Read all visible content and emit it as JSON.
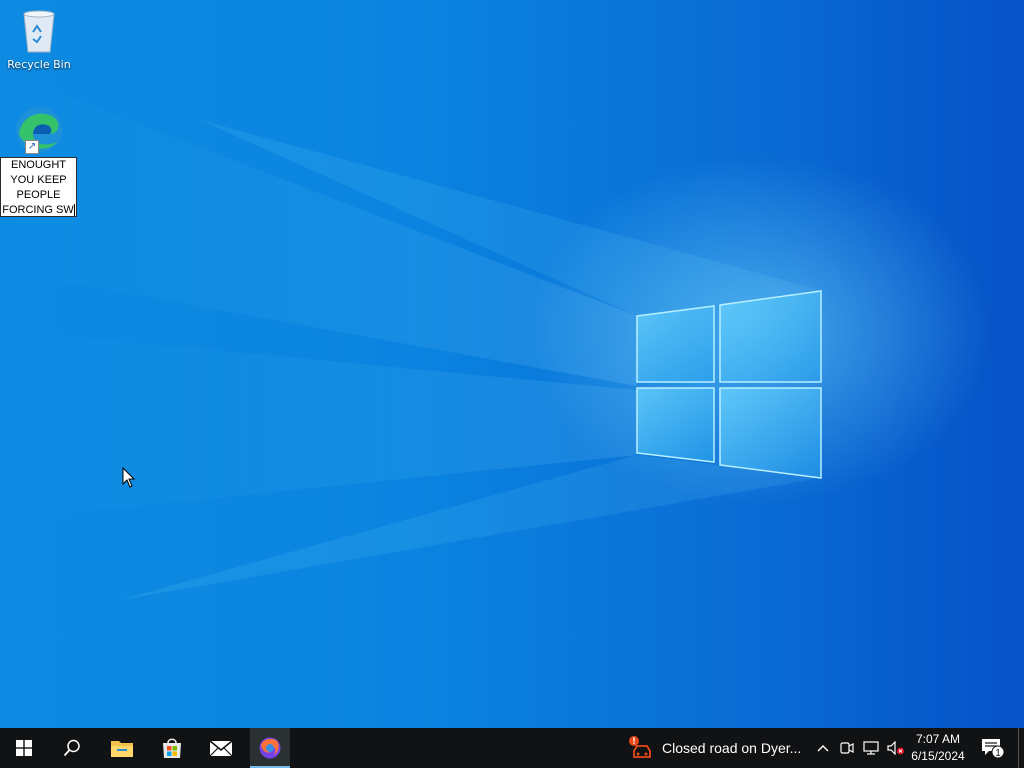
{
  "desktop": {
    "icons": [
      {
        "label": "Recycle Bin",
        "icon": "recycle-bin-icon"
      },
      {
        "label": "Microsoft Edge",
        "icon": "edge-icon",
        "renaming": true
      }
    ],
    "rename_text": [
      "ENOUGHT",
      "YOU KEEP",
      "PEOPLE",
      "FORCING SW"
    ]
  },
  "taskbar": {
    "start_icon": "windows-logo-icon",
    "search_icon": "search-icon",
    "pinned": [
      {
        "name": "File Explorer",
        "icon": "folder-icon"
      },
      {
        "name": "Microsoft Store",
        "icon": "store-icon"
      },
      {
        "name": "Mail",
        "icon": "mail-icon"
      },
      {
        "name": "Firefox",
        "icon": "firefox-icon",
        "active": true
      }
    ],
    "news_widget": {
      "text": "Closed road on Dyer...",
      "icon": "traffic-alert-icon"
    },
    "tray": {
      "chevron_icon": "chevron-up-icon",
      "meet_icon": "meet-now-icon",
      "network_icon": "network-icon",
      "volume_icon": "volume-muted-icon"
    },
    "clock": {
      "time": "7:07 AM",
      "date": "6/15/2024"
    },
    "notifications": {
      "icon": "action-center-icon",
      "count": "1"
    }
  },
  "colors": {
    "accent": "#0a84e0",
    "taskbar": "#101214",
    "active_indicator": "#76b9ed"
  }
}
